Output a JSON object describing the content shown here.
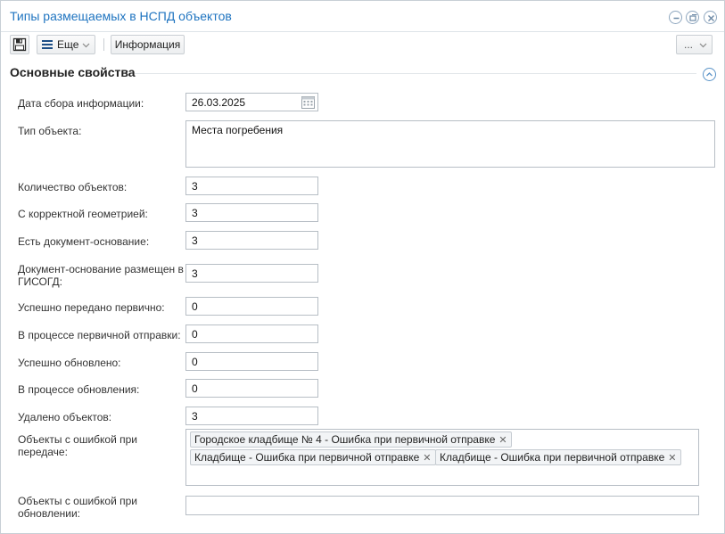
{
  "window": {
    "title": "Типы размещаемых в НСПД объектов"
  },
  "toolbar": {
    "more_label": "Еще",
    "info_label": "Информация",
    "ellipsis_label": "..."
  },
  "section": {
    "title": "Основные свойства"
  },
  "fields": {
    "date": {
      "label": "Дата сбора информации:",
      "value": "26.03.2025"
    },
    "object_type": {
      "label": "Тип объекта:",
      "value": "Места погребения"
    },
    "count": {
      "label": "Количество объектов:",
      "value": "3"
    },
    "correct_geometry": {
      "label": "С корректной геометрией:",
      "value": "3"
    },
    "has_document": {
      "label": "Есть документ-основание:",
      "value": "3"
    },
    "document_in_isogd_line1": "Документ-основание размещен в",
    "document_in_isogd_line2": "ГИСОГД:",
    "document_in_isogd_value": "3",
    "sent_primary": {
      "label": "Успешно передано первично:",
      "value": "0"
    },
    "in_primary_sending": {
      "label": "В процессе первичной отправки:",
      "value": "0"
    },
    "updated": {
      "label": "Успешно обновлено:",
      "value": "0"
    },
    "in_updating": {
      "label": "В процессе обновления:",
      "value": "0"
    },
    "deleted": {
      "label": "Удалено объектов:",
      "value": "3"
    },
    "errors_transfer_line1": "Объекты с ошибкой при",
    "errors_transfer_line2": "передаче:",
    "errors_transfer_tags": [
      "Городское кладбище № 4 - Ошибка при первичной отправке",
      "Кладбище - Ошибка при первичной отправке",
      "Кладбище - Ошибка при первичной отправке"
    ],
    "errors_update_line1": "Объекты с ошибкой при",
    "errors_update_line2": "обновлении:",
    "errors_update_value": ""
  },
  "icons": {
    "save": "save-icon",
    "menu": "menu-icon",
    "calendar": "calendar-icon",
    "minimize": "minimize-icon",
    "restore": "restore-icon",
    "close": "close-icon",
    "collapse": "chevron-up-icon"
  },
  "colors": {
    "title": "#1f74c0",
    "accent": "#5b94c8"
  }
}
